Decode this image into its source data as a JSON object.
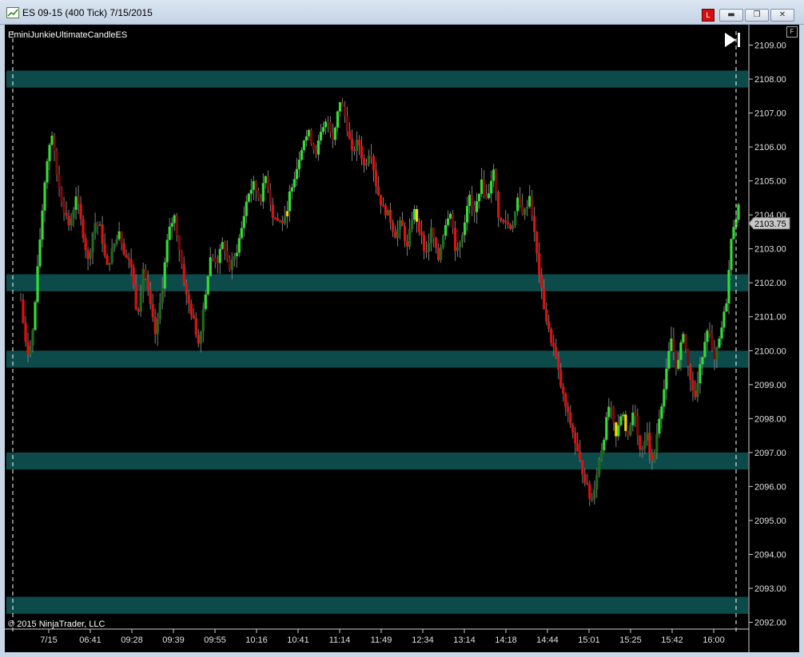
{
  "window": {
    "title": "ES 09-15 (400 Tick)  7/15/2015",
    "link_button": "L",
    "minimize_glyph": "▬",
    "maximize_glyph": "❐",
    "close_glyph": "✕",
    "f_button": "F"
  },
  "chart": {
    "indicator_label": "EminiJunkieUltimateCandleES",
    "copyright": "© 2015 NinjaTrader, LLC",
    "current_price_label": "2103.75",
    "play_icon": "play-end-icon",
    "colors": {
      "background": "#000000",
      "zone": "#0d4b4b",
      "axis_text": "#e0e0e0",
      "dark_green": "#1e6b1e",
      "bright_green": "#33dd33",
      "red": "#e01010",
      "dark_red": "#7a0a0a",
      "yellow": "#ffd400",
      "gray": "#808080"
    }
  },
  "chart_data": {
    "type": "line",
    "title": "",
    "xlabel": "",
    "ylabel": "",
    "ylim": [
      2091.8,
      2109.6
    ],
    "y_ticks": [
      "2109.00",
      "2108.00",
      "2107.00",
      "2106.00",
      "2105.00",
      "2104.00",
      "2103.00",
      "2102.00",
      "2101.00",
      "2100.00",
      "2099.00",
      "2098.00",
      "2097.00",
      "2096.00",
      "2095.00",
      "2094.00",
      "2093.00",
      "2092.00"
    ],
    "x_ticks": [
      "7/15",
      "06:41",
      "09:28",
      "09:39",
      "09:55",
      "10:16",
      "10:41",
      "11:14",
      "11:49",
      "12:34",
      "13:14",
      "14:18",
      "14:44",
      "15:01",
      "15:25",
      "15:42",
      "16:00"
    ],
    "zones": [
      [
        2107.75,
        2108.25
      ],
      [
        2101.75,
        2102.25
      ],
      [
        2099.5,
        2100.0
      ],
      [
        2096.5,
        2097.0
      ],
      [
        2092.25,
        2092.75
      ]
    ],
    "last_price": 2103.75,
    "series": [
      {
        "values": [
          2101.5,
          2099.8,
          2100.6,
          2103.0,
          2105.2,
          2106.5,
          2105.0,
          2104.2,
          2103.6,
          2104.6,
          2103.6,
          2102.6,
          2103.8,
          2103.6,
          2102.4,
          2103.0,
          2103.6,
          2102.8,
          2102.5,
          2101.0,
          2102.5,
          2101.4,
          2100.4,
          2101.8,
          2103.4,
          2104.0,
          2102.8,
          2101.6,
          2101.0,
          2100.2,
          2101.6,
          2102.8,
          2102.6,
          2103.2,
          2102.4,
          2102.8,
          2103.6,
          2104.6,
          2104.9,
          2104.4,
          2105.2,
          2104.0,
          2103.8,
          2103.8,
          2104.8,
          2105.4,
          2106.2,
          2106.4,
          2105.8,
          2106.4,
          2106.8,
          2106.2,
          2107.4,
          2106.8,
          2105.8,
          2106.2,
          2105.4,
          2106.0,
          2104.8,
          2104.2,
          2104.0,
          2103.4,
          2103.8,
          2103.0,
          2104.2,
          2103.6,
          2102.8,
          2103.6,
          2102.6,
          2103.6,
          2104.2,
          2102.8,
          2103.4,
          2104.6,
          2104.0,
          2105.0,
          2104.4,
          2105.4,
          2103.8,
          2103.8,
          2103.6,
          2104.4,
          2104.0,
          2104.6,
          2103.0,
          2101.6,
          2100.6,
          2100.0,
          2099.0,
          2098.2,
          2097.6,
          2096.8,
          2096.2,
          2095.5,
          2096.5,
          2097.4,
          2098.5,
          2097.4,
          2098.2,
          2097.4,
          2098.4,
          2097.0,
          2097.6,
          2096.6,
          2098.0,
          2099.0,
          2100.4,
          2099.4,
          2100.6,
          2099.2,
          2098.6,
          2099.8,
          2100.8,
          2099.6,
          2100.4,
          2101.4,
          2103.6,
          2104.2
        ]
      }
    ]
  }
}
